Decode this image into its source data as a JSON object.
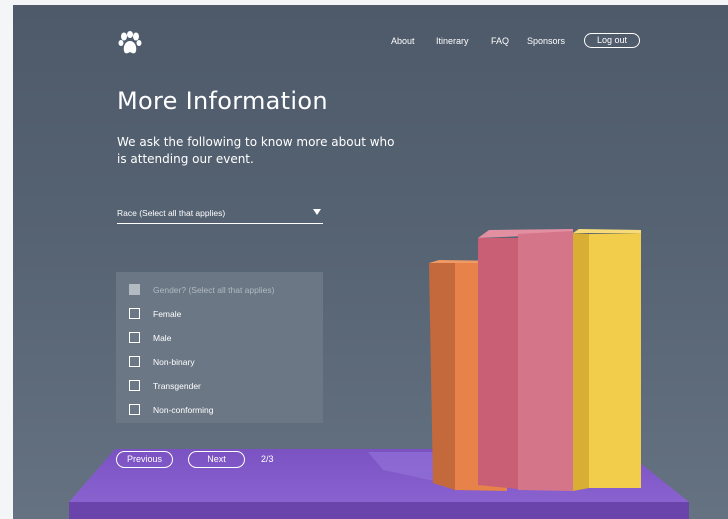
{
  "nav": {
    "logo": "paw-icon",
    "links": [
      "About",
      "Itinerary",
      "FAQ",
      "Sponsors"
    ],
    "logout_label": "Log out"
  },
  "header": {
    "title": "More Information",
    "subtitle": "We ask the following to know more about who is attending our event."
  },
  "form": {
    "race": {
      "label": "Race (Select all that applies)",
      "icon": "caret-down-icon"
    },
    "gender": {
      "heading": "Gender? (Select all that applies)",
      "options": [
        "Female",
        "Male",
        "Non-binary",
        "Transgender",
        "Non-conforming"
      ]
    }
  },
  "pagination": {
    "previous_label": "Previous",
    "next_label": "Next",
    "step": "2/3"
  },
  "colors": {
    "background": "#566373",
    "panel": "#6b7785",
    "floor": "#7f58c4",
    "book_orange": "#e6824a",
    "book_pink": "#d5758a",
    "book_yellow": "#f2cd4c"
  }
}
